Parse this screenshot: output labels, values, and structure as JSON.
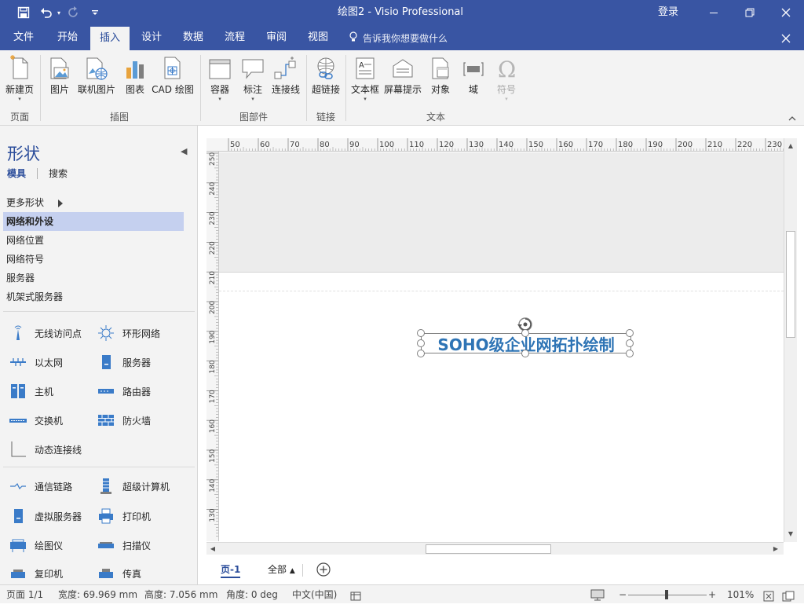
{
  "app": {
    "title": "绘图2 - Visio Professional",
    "sign_in": "登录",
    "accent_color": "#3955a3",
    "ribbon_bg": "#f3f3f3"
  },
  "quick_access": {
    "save_icon": "save-icon",
    "undo_icon": "undo-icon",
    "redo_icon": "redo-icon",
    "customize_icon": "customize-qat-icon"
  },
  "tabs": [
    {
      "label": "文件"
    },
    {
      "label": "开始"
    },
    {
      "label": "插入",
      "active": true
    },
    {
      "label": "设计"
    },
    {
      "label": "数据"
    },
    {
      "label": "流程"
    },
    {
      "label": "审阅"
    },
    {
      "label": "视图"
    }
  ],
  "tell_me": "告诉我你想要做什么",
  "ribbon": {
    "groups": [
      {
        "label": "页面",
        "buttons": [
          {
            "label": "新建页",
            "icon": "new-page-icon",
            "dropdown": true
          }
        ]
      },
      {
        "label": "插图",
        "buttons": [
          {
            "label": "图片",
            "icon": "picture-icon"
          },
          {
            "label": "联机图片",
            "icon": "online-picture-icon"
          },
          {
            "label": "图表",
            "icon": "chart-icon"
          },
          {
            "label": "CAD 绘图",
            "icon": "cad-drawing-icon"
          }
        ]
      },
      {
        "label": "图部件",
        "buttons": [
          {
            "label": "容器",
            "icon": "container-icon",
            "dropdown": true
          },
          {
            "label": "标注",
            "icon": "callout-icon",
            "dropdown": true
          },
          {
            "label": "连接线",
            "icon": "connector-icon"
          }
        ]
      },
      {
        "label": "链接",
        "buttons": [
          {
            "label": "超链接",
            "icon": "hyperlink-icon"
          }
        ]
      },
      {
        "label": "文本",
        "buttons": [
          {
            "label": "文本框",
            "icon": "textbox-icon",
            "dropdown": true
          },
          {
            "label": "屏幕提示",
            "icon": "screentip-icon"
          },
          {
            "label": "对象",
            "icon": "object-icon"
          },
          {
            "label": "域",
            "icon": "field-icon"
          },
          {
            "label": "符号",
            "icon": "symbol-icon",
            "dropdown": true,
            "disabled": true
          }
        ]
      }
    ]
  },
  "shapes_pane": {
    "title": "形状",
    "tab_stencils": "模具",
    "tab_search": "搜索",
    "more_shapes": "更多形状",
    "stencils": [
      "网络和外设",
      "网络位置",
      "网络符号",
      "服务器",
      "机架式服务器"
    ],
    "active_stencil": "网络和外设",
    "shapes_group1": [
      {
        "label": "无线访问点",
        "icon": "wireless-access-point-icon"
      },
      {
        "label": "环形网络",
        "icon": "ring-network-icon"
      },
      {
        "label": "以太网",
        "icon": "ethernet-icon"
      },
      {
        "label": "服务器",
        "icon": "server-icon"
      },
      {
        "label": "主机",
        "icon": "mainframe-icon"
      },
      {
        "label": "路由器",
        "icon": "router-icon"
      },
      {
        "label": "交换机",
        "icon": "switch-icon"
      },
      {
        "label": "防火墙",
        "icon": "firewall-icon"
      },
      {
        "label": "动态连接线",
        "icon": "dynamic-connector-icon"
      }
    ],
    "shapes_group2": [
      {
        "label": "通信链路",
        "icon": "comm-link-icon"
      },
      {
        "label": "超级计算机",
        "icon": "supercomputer-icon"
      },
      {
        "label": "虚拟服务器",
        "icon": "virtual-server-icon"
      },
      {
        "label": "打印机",
        "icon": "printer-icon"
      },
      {
        "label": "绘图仪",
        "icon": "plotter-icon"
      },
      {
        "label": "扫描仪",
        "icon": "scanner-icon"
      },
      {
        "label": "复印机",
        "icon": "copier-icon"
      },
      {
        "label": "传真",
        "icon": "fax-icon"
      }
    ]
  },
  "ruler": {
    "top_ticks": [
      "50",
      "60",
      "70",
      "80",
      "90",
      "100",
      "110",
      "120",
      "130",
      "140",
      "150",
      "160",
      "170",
      "180",
      "190",
      "200",
      "210",
      "220",
      "230"
    ],
    "left_ticks": [
      "250",
      "240",
      "230",
      "220",
      "210",
      "200",
      "190",
      "180",
      "170",
      "160",
      "150",
      "140",
      "130"
    ]
  },
  "canvas": {
    "selected_text": "SOHO级企业网拓扑绘制",
    "text_color": "#2e74b5"
  },
  "page_tabs": {
    "page": "页-1",
    "all": "全部"
  },
  "status": {
    "page": "页面 1/1",
    "width": "宽度: 69.969 mm",
    "height": "高度: 7.056 mm",
    "angle": "角度: 0 deg",
    "language": "中文(中国)",
    "zoom": "101%"
  }
}
